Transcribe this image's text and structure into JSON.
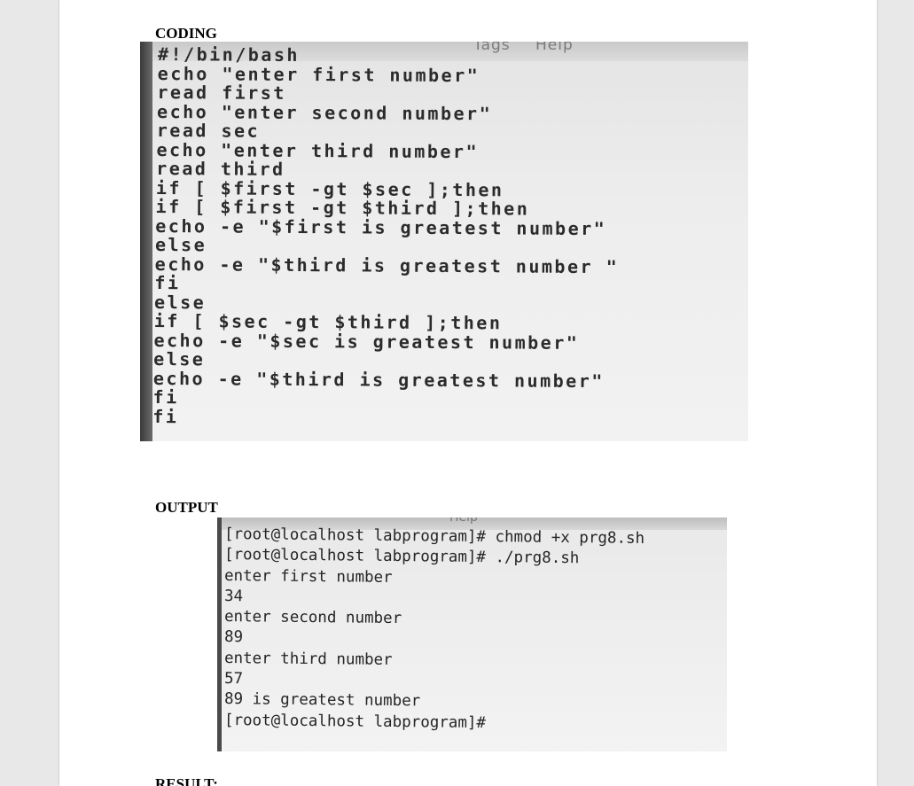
{
  "sections": {
    "coding_heading": "CODING",
    "output_heading": "OUTPUT",
    "result_heading": "RESULT:"
  },
  "code_screenshot": {
    "menu_fragments": [
      "Tags",
      "Help"
    ],
    "lines": [
      "#!/bin/bash",
      "echo \"enter first number\"",
      "read first",
      "echo \"enter second number\"",
      "read sec",
      "echo \"enter third number\"",
      "read third",
      "if [ $first -gt $sec ];then",
      "if [ $first -gt $third ];then",
      "echo -e \"$first is greatest number\"",
      "else",
      "echo -e \"$third is greatest number \"",
      "fi",
      "else",
      "if [ $sec -gt $third ];then",
      "echo -e \"$sec is greatest number\"",
      "else",
      "echo -e \"$third is greatest number\"",
      "fi",
      "fi"
    ]
  },
  "output_screenshot": {
    "menu_fragment": "Help",
    "lines": [
      "[root@localhost labprogram]# chmod +x prg8.sh",
      "[root@localhost labprogram]# ./prg8.sh",
      "enter first number",
      "34",
      "enter second number",
      "89",
      "enter third number",
      "57",
      "89 is greatest number",
      "[root@localhost labprogram]#"
    ]
  }
}
